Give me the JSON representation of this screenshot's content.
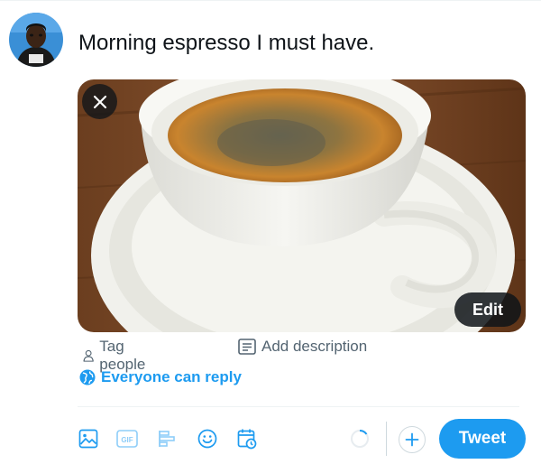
{
  "composer": {
    "tweet_text": "Morning espresso I must have."
  },
  "media": {
    "image_subject": "espresso cup on saucer",
    "edit_label": "Edit"
  },
  "media_actions": {
    "tag_people_label": "Tag people",
    "add_description_label": "Add description"
  },
  "reply_setting": {
    "label": "Everyone can reply"
  },
  "toolbar": {
    "icons": [
      "image-icon",
      "gif-icon",
      "poll-icon",
      "emoji-icon",
      "schedule-icon"
    ],
    "gif_label": "GIF",
    "tweet_button_label": "Tweet"
  },
  "colors": {
    "accent": "#1d9bf0",
    "secondary_text": "#536471",
    "primary_text": "#0f1419"
  }
}
